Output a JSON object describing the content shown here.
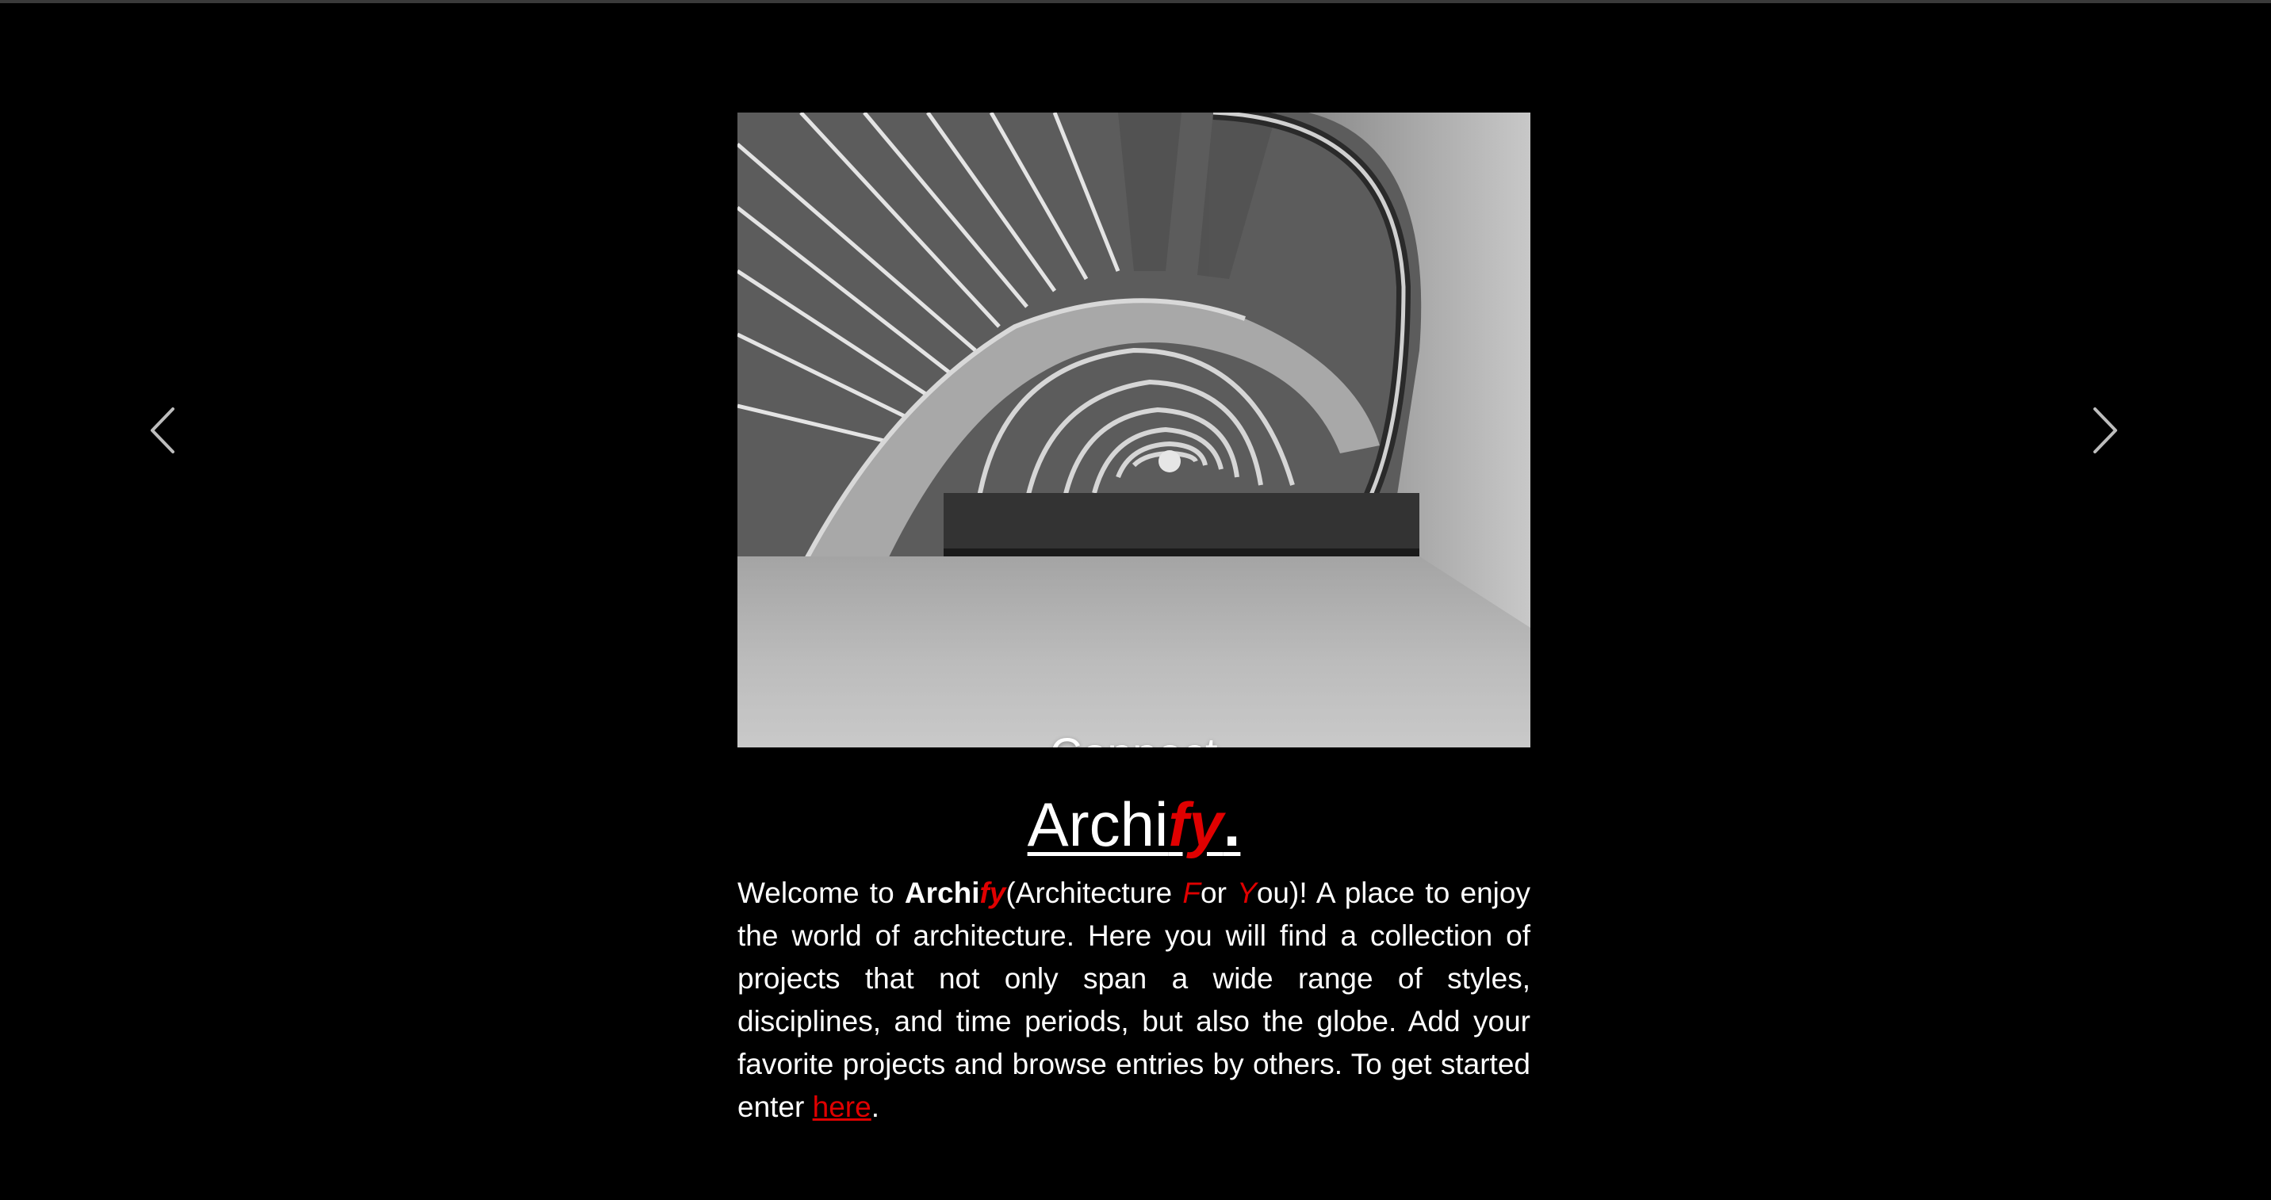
{
  "carousel": {
    "caption": "Connect",
    "indicators": [
      {
        "active": false
      },
      {
        "active": false
      },
      {
        "active": true
      }
    ],
    "prev_icon": "chevron-left-icon",
    "next_icon": "chevron-right-icon"
  },
  "brand": {
    "part1": "Archi",
    "part2": "fy",
    "part3": "."
  },
  "intro": {
    "t1": "Welcome to ",
    "brand_a": "Archi",
    "brand_b": "fy",
    "t2": "(Architecture ",
    "f_letter": "F",
    "t3": "or ",
    "y_letter": "Y",
    "t4": "ou)! A place to enjoy the world of architecture. Here you will find a collection of projects that not only span a wide range of styles, disciplines, and time periods, but also the globe. Add your favorite projects and browse entries by others. To get started enter ",
    "link_text": "here",
    "t5": "."
  },
  "colors": {
    "background": "#000000",
    "accent": "#e00000",
    "text": "#ffffff"
  }
}
